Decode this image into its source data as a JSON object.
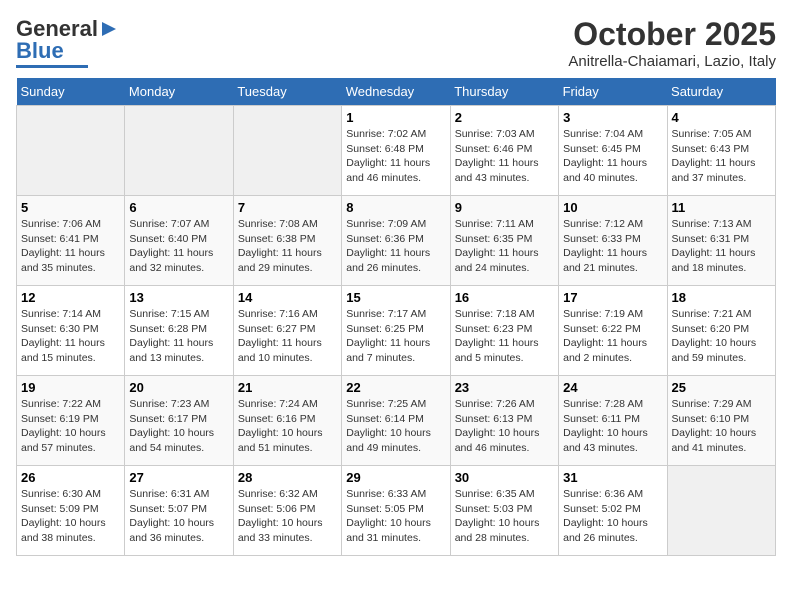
{
  "header": {
    "logo_general": "General",
    "logo_blue": "Blue",
    "month_title": "October 2025",
    "location": "Anitrella-Chaiamari, Lazio, Italy"
  },
  "weekdays": [
    "Sunday",
    "Monday",
    "Tuesday",
    "Wednesday",
    "Thursday",
    "Friday",
    "Saturday"
  ],
  "weeks": [
    [
      {
        "day": "",
        "info": ""
      },
      {
        "day": "",
        "info": ""
      },
      {
        "day": "",
        "info": ""
      },
      {
        "day": "1",
        "info": "Sunrise: 7:02 AM\nSunset: 6:48 PM\nDaylight: 11 hours\nand 46 minutes."
      },
      {
        "day": "2",
        "info": "Sunrise: 7:03 AM\nSunset: 6:46 PM\nDaylight: 11 hours\nand 43 minutes."
      },
      {
        "day": "3",
        "info": "Sunrise: 7:04 AM\nSunset: 6:45 PM\nDaylight: 11 hours\nand 40 minutes."
      },
      {
        "day": "4",
        "info": "Sunrise: 7:05 AM\nSunset: 6:43 PM\nDaylight: 11 hours\nand 37 minutes."
      }
    ],
    [
      {
        "day": "5",
        "info": "Sunrise: 7:06 AM\nSunset: 6:41 PM\nDaylight: 11 hours\nand 35 minutes."
      },
      {
        "day": "6",
        "info": "Sunrise: 7:07 AM\nSunset: 6:40 PM\nDaylight: 11 hours\nand 32 minutes."
      },
      {
        "day": "7",
        "info": "Sunrise: 7:08 AM\nSunset: 6:38 PM\nDaylight: 11 hours\nand 29 minutes."
      },
      {
        "day": "8",
        "info": "Sunrise: 7:09 AM\nSunset: 6:36 PM\nDaylight: 11 hours\nand 26 minutes."
      },
      {
        "day": "9",
        "info": "Sunrise: 7:11 AM\nSunset: 6:35 PM\nDaylight: 11 hours\nand 24 minutes."
      },
      {
        "day": "10",
        "info": "Sunrise: 7:12 AM\nSunset: 6:33 PM\nDaylight: 11 hours\nand 21 minutes."
      },
      {
        "day": "11",
        "info": "Sunrise: 7:13 AM\nSunset: 6:31 PM\nDaylight: 11 hours\nand 18 minutes."
      }
    ],
    [
      {
        "day": "12",
        "info": "Sunrise: 7:14 AM\nSunset: 6:30 PM\nDaylight: 11 hours\nand 15 minutes."
      },
      {
        "day": "13",
        "info": "Sunrise: 7:15 AM\nSunset: 6:28 PM\nDaylight: 11 hours\nand 13 minutes."
      },
      {
        "day": "14",
        "info": "Sunrise: 7:16 AM\nSunset: 6:27 PM\nDaylight: 11 hours\nand 10 minutes."
      },
      {
        "day": "15",
        "info": "Sunrise: 7:17 AM\nSunset: 6:25 PM\nDaylight: 11 hours\nand 7 minutes."
      },
      {
        "day": "16",
        "info": "Sunrise: 7:18 AM\nSunset: 6:23 PM\nDaylight: 11 hours\nand 5 minutes."
      },
      {
        "day": "17",
        "info": "Sunrise: 7:19 AM\nSunset: 6:22 PM\nDaylight: 11 hours\nand 2 minutes."
      },
      {
        "day": "18",
        "info": "Sunrise: 7:21 AM\nSunset: 6:20 PM\nDaylight: 10 hours\nand 59 minutes."
      }
    ],
    [
      {
        "day": "19",
        "info": "Sunrise: 7:22 AM\nSunset: 6:19 PM\nDaylight: 10 hours\nand 57 minutes."
      },
      {
        "day": "20",
        "info": "Sunrise: 7:23 AM\nSunset: 6:17 PM\nDaylight: 10 hours\nand 54 minutes."
      },
      {
        "day": "21",
        "info": "Sunrise: 7:24 AM\nSunset: 6:16 PM\nDaylight: 10 hours\nand 51 minutes."
      },
      {
        "day": "22",
        "info": "Sunrise: 7:25 AM\nSunset: 6:14 PM\nDaylight: 10 hours\nand 49 minutes."
      },
      {
        "day": "23",
        "info": "Sunrise: 7:26 AM\nSunset: 6:13 PM\nDaylight: 10 hours\nand 46 minutes."
      },
      {
        "day": "24",
        "info": "Sunrise: 7:28 AM\nSunset: 6:11 PM\nDaylight: 10 hours\nand 43 minutes."
      },
      {
        "day": "25",
        "info": "Sunrise: 7:29 AM\nSunset: 6:10 PM\nDaylight: 10 hours\nand 41 minutes."
      }
    ],
    [
      {
        "day": "26",
        "info": "Sunrise: 6:30 AM\nSunset: 5:09 PM\nDaylight: 10 hours\nand 38 minutes."
      },
      {
        "day": "27",
        "info": "Sunrise: 6:31 AM\nSunset: 5:07 PM\nDaylight: 10 hours\nand 36 minutes."
      },
      {
        "day": "28",
        "info": "Sunrise: 6:32 AM\nSunset: 5:06 PM\nDaylight: 10 hours\nand 33 minutes."
      },
      {
        "day": "29",
        "info": "Sunrise: 6:33 AM\nSunset: 5:05 PM\nDaylight: 10 hours\nand 31 minutes."
      },
      {
        "day": "30",
        "info": "Sunrise: 6:35 AM\nSunset: 5:03 PM\nDaylight: 10 hours\nand 28 minutes."
      },
      {
        "day": "31",
        "info": "Sunrise: 6:36 AM\nSunset: 5:02 PM\nDaylight: 10 hours\nand 26 minutes."
      },
      {
        "day": "",
        "info": ""
      }
    ]
  ]
}
